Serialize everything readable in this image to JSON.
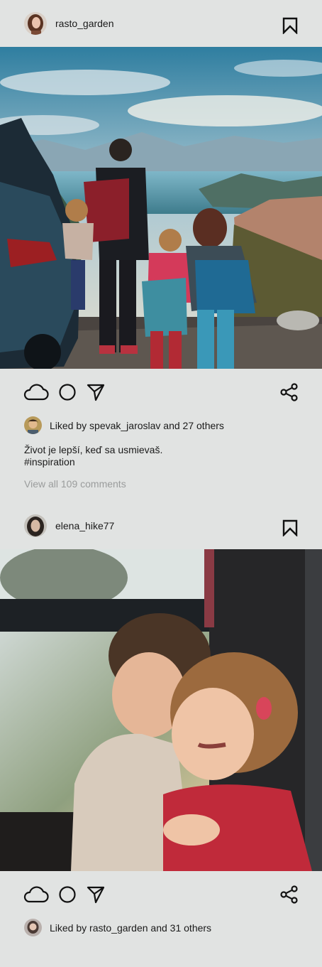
{
  "posts": [
    {
      "username": "rasto_garden",
      "likes_text": "Liked by spevak_jaroslav and 27 others",
      "caption_line1": "Život je lepší, keď sa usmievaš.",
      "caption_line2": "#inspiration",
      "view_comments": "View all 109 comments",
      "photo_icon": "family-mountain-photo"
    },
    {
      "username": "elena_hike77",
      "likes_text": "Liked by rasto_garden and 31 others",
      "photo_icon": "children-train-window-photo"
    }
  ],
  "icons": [
    "bookmark-icon",
    "cloud-like-icon",
    "comment-circle-icon",
    "send-icon",
    "share-icon"
  ],
  "colors": {
    "background": "#e1e3e2",
    "muted_text": "#9a9c9c"
  }
}
